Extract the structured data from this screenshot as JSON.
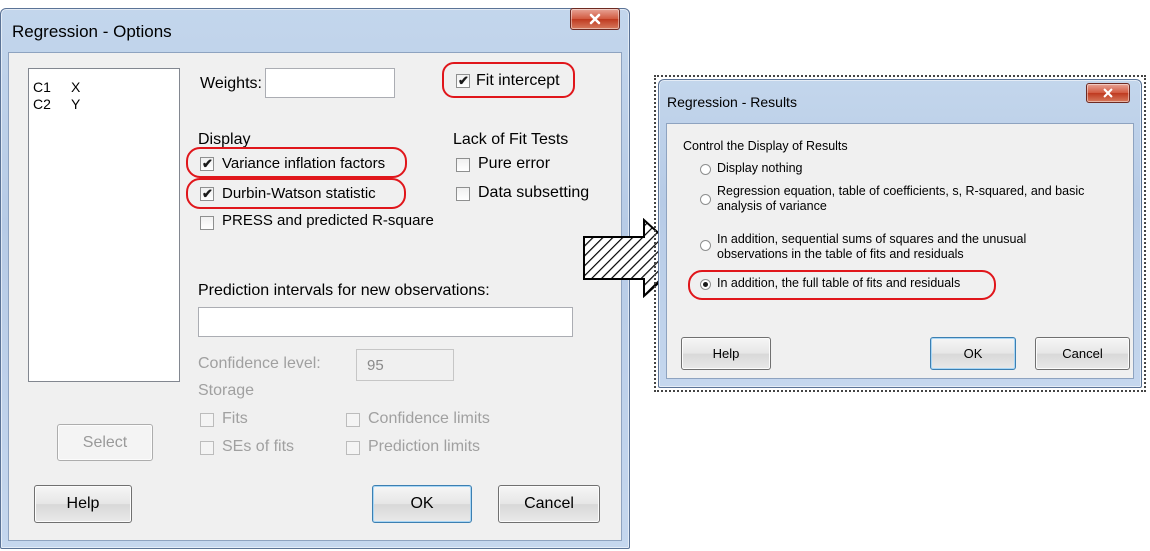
{
  "options_dialog": {
    "title": "Regression - Options",
    "variables": [
      {
        "col": "C1",
        "name": "X"
      },
      {
        "col": "C2",
        "name": "Y"
      }
    ],
    "weights_label": "Weights:",
    "weights_value": "",
    "fit_intercept_label": "Fit intercept",
    "fit_intercept_checked": true,
    "display_header": "Display",
    "vif_label": "Variance inflation factors",
    "vif_checked": true,
    "durbin_watson_label": "Durbin-Watson statistic",
    "durbin_watson_checked": true,
    "press_label": "PRESS and predicted R-square",
    "press_checked": false,
    "lack_of_fit_header": "Lack of Fit Tests",
    "pure_error_label": "Pure error",
    "data_subsetting_label": "Data subsetting",
    "prediction_label": "Prediction intervals for new observations:",
    "prediction_value": "",
    "confidence_label": "Confidence level:",
    "confidence_value": "95",
    "storage_header": "Storage",
    "fits_label": "Fits",
    "ses_fits_label": "SEs of fits",
    "confidence_limits_label": "Confidence limits",
    "prediction_limits_label": "Prediction limits",
    "select_button": "Select",
    "help_button": "Help",
    "ok_button": "OK",
    "cancel_button": "Cancel"
  },
  "results_dialog": {
    "title": "Regression - Results",
    "group_label": "Control the Display of Results",
    "options": [
      {
        "lines": [
          "Display nothing"
        ],
        "selected": false
      },
      {
        "lines": [
          "Regression equation, table of coefficients, s, R-squared, and basic",
          "analysis of variance"
        ],
        "selected": false
      },
      {
        "lines": [
          "In addition, sequential sums of squares and the unusual",
          "observations in the table of fits and residuals"
        ],
        "selected": false
      },
      {
        "lines": [
          "In addition, the full table of fits and residuals"
        ],
        "selected": true
      }
    ],
    "help_button": "Help",
    "ok_button": "OK",
    "cancel_button": "Cancel"
  },
  "colors": {
    "highlight": "#e0161b",
    "close_button": "#c9452b",
    "dialog_background": "#f0f0f0"
  },
  "icons": [
    "close-icon",
    "arrow-right-icon",
    "checkmark-icon",
    "radio-dot-icon"
  ]
}
